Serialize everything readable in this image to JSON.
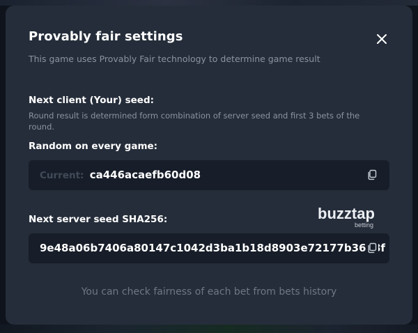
{
  "modal": {
    "title": "Provably fair settings",
    "subtitle": "This game uses Provably Fair technology to determine game result",
    "client_seed": {
      "label": "Next client (Your) seed:",
      "description": "Round result is determined form combination of server seed and first 3 bets of the round.",
      "mode_label": "Random on every game:",
      "current_prefix": "Current:",
      "current_value": "ca446acaefb60d08"
    },
    "server_seed": {
      "label": "Next server seed SHA256:",
      "value": "9e48a06b7406a80147c1042d3ba1b18d8903e72177b3608f"
    },
    "footer_note": "You can check fairness of each bet from bets history",
    "watermark": {
      "brand": "buzztap",
      "sub": "betting"
    }
  },
  "icons": {
    "close": "close-icon",
    "copy": "copy-icon"
  },
  "colors": {
    "modal_bg": "#252d3a",
    "field_bg": "#171e29",
    "text_primary": "#ffffff",
    "text_muted": "#8a93a3",
    "text_dim": "#414a58"
  }
}
